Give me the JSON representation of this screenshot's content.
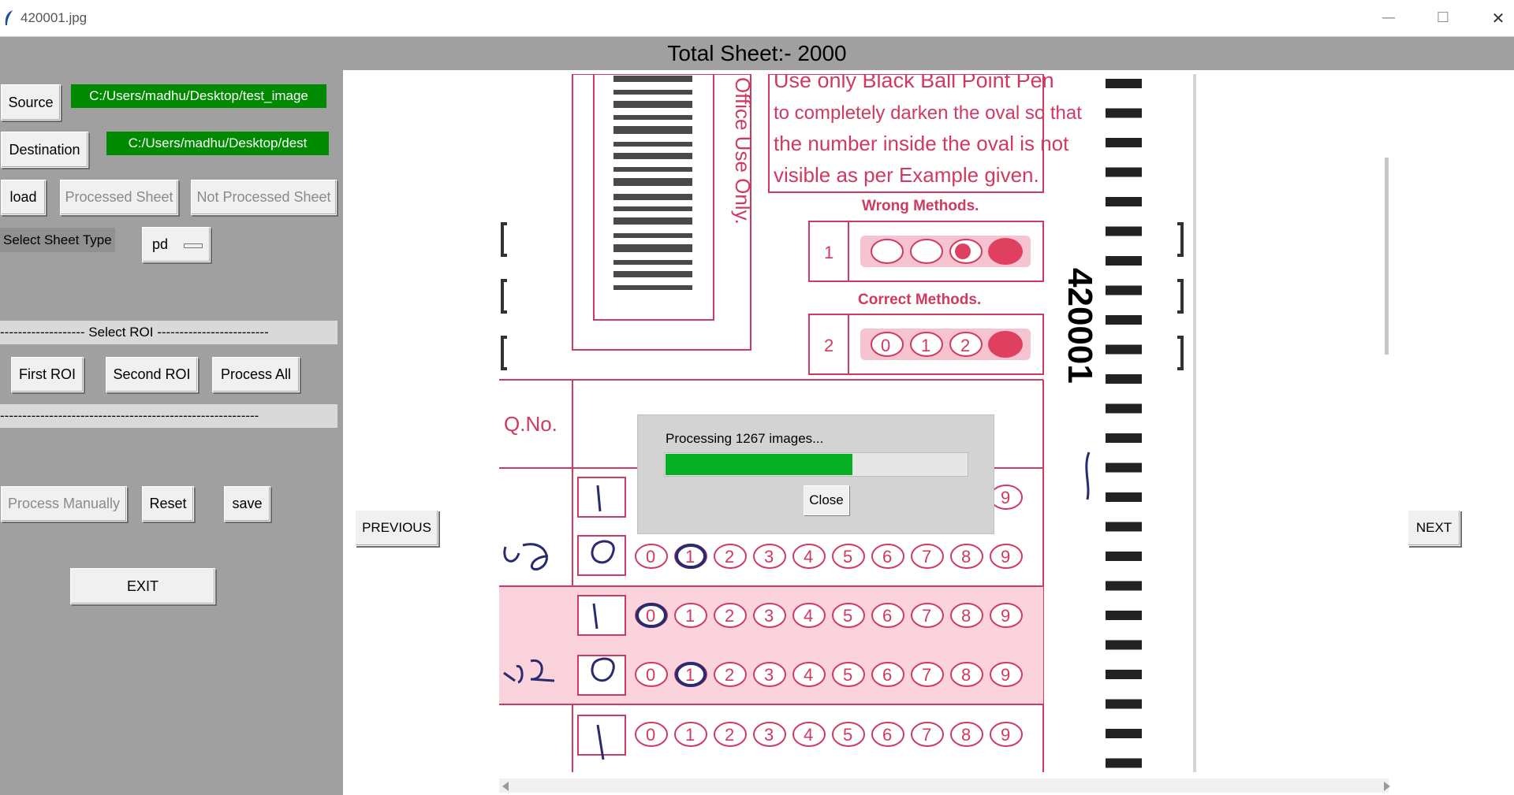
{
  "window": {
    "title": "420001.jpg",
    "minimize_glyph": "—",
    "maximize_glyph": "☐",
    "close_glyph": "✕"
  },
  "header": {
    "text": "Total Sheet:-  2000"
  },
  "left_panel": {
    "source_button": "Source",
    "source_path": "C:/Users/madhu/Desktop/test_image",
    "destination_button": "Destination",
    "destination_path": "C:/Users/madhu/Desktop/dest",
    "load_button": "load",
    "processed_button": "Processed Sheet",
    "not_processed_button": "Not Processed Sheet",
    "sheet_type_label": "Select Sheet Type",
    "sheet_type_value": "pd",
    "select_roi_label": "------------------- Select ROI -------------------------",
    "roi_bottom_line": "----------------------------------------------------------",
    "first_roi_button": "First ROI",
    "second_roi_button": "Second ROI",
    "process_all_button": "Process All",
    "process_manually_button": "Process Manually",
    "reset_button": "Reset",
    "save_button": "save",
    "exit_button": "EXIT"
  },
  "nav": {
    "previous_button": "PREVIOUS",
    "next_button": "NEXT"
  },
  "sheet": {
    "instructions": [
      "Use only Black Ball Point Pen",
      "to completely darken the  oval  so that",
      "the number inside the oval is not",
      "visible as per Example given."
    ],
    "office_use": "Office Use Only.",
    "wrong_methods_label": "Wrong Methods.",
    "correct_methods_label": "Correct Methods.",
    "example_row_1": "1",
    "example_row_2": "2",
    "correct_digits": [
      "0",
      "1",
      "2"
    ],
    "sheet_number": "420001",
    "qno_label": "Q.No.",
    "digits": [
      "0",
      "1",
      "2",
      "3",
      "4",
      "5",
      "6",
      "7",
      "8",
      "9"
    ]
  },
  "dialog": {
    "message": "Processing 1267 images...",
    "progress_fraction": 0.62,
    "close_button": "Close"
  },
  "colors": {
    "path_green": "#008a00",
    "progress_green": "#06b025",
    "sheet_pink": "#d03a60",
    "shaded_row": "#fbd3dc"
  }
}
